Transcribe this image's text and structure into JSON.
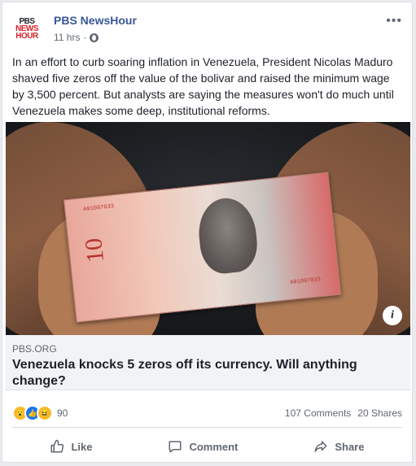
{
  "post": {
    "page_name": "PBS NewsHour",
    "logo_lines": [
      "PBS",
      "NEWS",
      "HOUR"
    ],
    "time": "11 hrs",
    "separator": "·",
    "more": "•••",
    "text": "In an effort to curb soaring inflation in Venezuela, President Nicolas Maduro shaved five zeros off the value of the bolivar and raised the minimum wage by 3,500 percent. But analysts are saying the measures won't do much until Venezuela makes some deep, institutional reforms."
  },
  "photo": {
    "bill_denomination": "10",
    "bill_serial": "A91007033",
    "info_label": "i"
  },
  "link": {
    "domain": "PBS.ORG",
    "title": "Venezuela knocks 5 zeros off its currency. Will anything change?"
  },
  "engagement": {
    "reaction_count": "90",
    "comments": "107 Comments",
    "shares": "20 Shares"
  },
  "actions": {
    "like": "Like",
    "comment": "Comment",
    "share": "Share"
  },
  "colors": {
    "page_name": "#385898",
    "brand_red": "#d8232a",
    "like_blue": "#1877f2",
    "muted": "#606770"
  }
}
